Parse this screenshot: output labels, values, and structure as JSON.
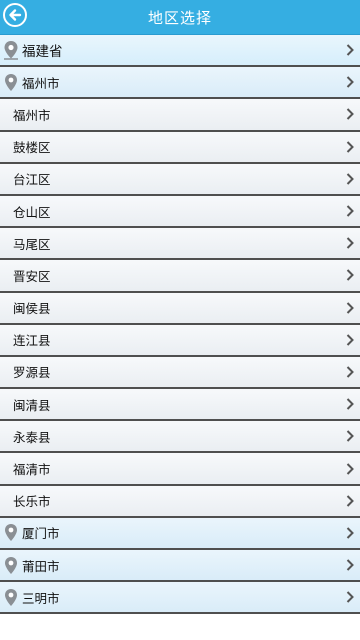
{
  "header": {
    "title": "地区选择",
    "back_icon": "arrow-left-circle-icon",
    "bg_color": "#35aee2"
  },
  "province": {
    "label": "福建省",
    "icon": "map-pin-icon"
  },
  "cities": [
    {
      "label": "福州市",
      "icon": "map-pin-icon",
      "districts": [
        "福州市",
        "鼓楼区",
        "台江区",
        "仓山区",
        "马尾区",
        "晋安区",
        "闽侯县",
        "连江县",
        "罗源县",
        "闽清县",
        "永泰县",
        "福清市",
        "长乐市"
      ]
    },
    {
      "label": "厦门市",
      "icon": "map-pin-icon"
    },
    {
      "label": "莆田市",
      "icon": "map-pin-icon"
    },
    {
      "label": "三明市",
      "icon": "map-pin-icon"
    }
  ],
  "chevron_icon": "chevron-right-icon"
}
